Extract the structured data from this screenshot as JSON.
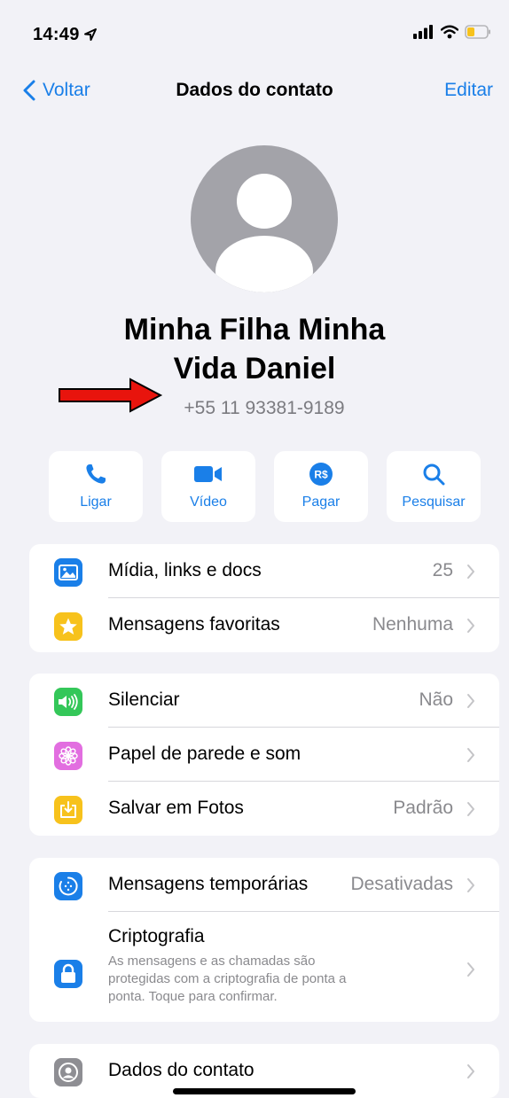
{
  "status_bar": {
    "time": "14:49"
  },
  "nav": {
    "back_label": "Voltar",
    "title": "Dados do contato",
    "edit_label": "Editar"
  },
  "profile": {
    "name_line1": "Minha Filha Minha",
    "name_line2": "Vida Daniel",
    "phone": "+55 11 93381-9189"
  },
  "actions": [
    {
      "label": "Ligar",
      "icon": "phone-icon"
    },
    {
      "label": "Vídeo",
      "icon": "video-camera-icon"
    },
    {
      "label": "Pagar",
      "icon": "payment-rs-icon"
    },
    {
      "label": "Pesquisar",
      "icon": "search-icon"
    }
  ],
  "group1": [
    {
      "label": "Mídia, links e docs",
      "value": "25",
      "icon": "photo-icon",
      "color": "#1a7fe8"
    },
    {
      "label": "Mensagens favoritas",
      "value": "Nenhuma",
      "icon": "star-icon",
      "color": "#f7c21c"
    }
  ],
  "group2": [
    {
      "label": "Silenciar",
      "value": "Não",
      "icon": "speaker-icon",
      "color": "#34c759"
    },
    {
      "label": "Papel de parede e som",
      "value": "",
      "icon": "flower-icon",
      "color": "#e26ee0"
    },
    {
      "label": "Salvar em Fotos",
      "value": "Padrão",
      "icon": "save-icon",
      "color": "#f7c21c"
    }
  ],
  "group3": [
    {
      "label": "Mensagens temporárias",
      "value": "Desativadas",
      "icon": "timer-icon",
      "color": "#1a7fe8"
    },
    {
      "label": "Criptografia",
      "desc": "As mensagens e as chamadas são protegidas com a criptografia de ponta a ponta. Toque para confirmar.",
      "icon": "lock-icon",
      "color": "#1a7fe8"
    }
  ],
  "group4": [
    {
      "label": "Dados do contato",
      "value": "",
      "icon": "contact-icon",
      "color": "#8e8e93"
    }
  ]
}
